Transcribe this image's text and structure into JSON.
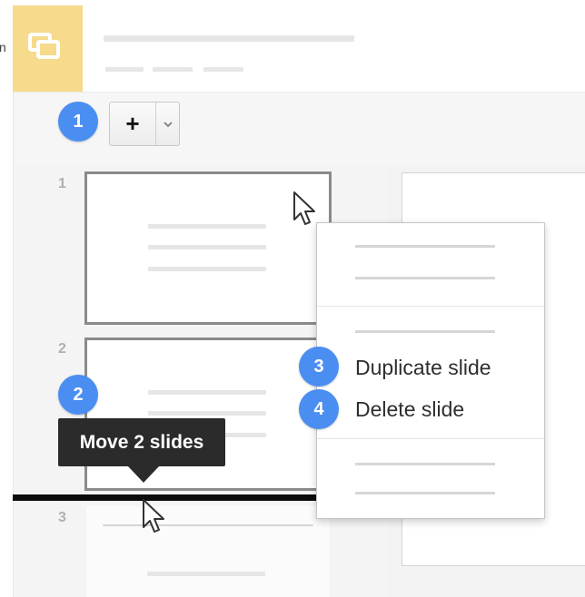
{
  "edge_text": "n",
  "toolbar": {
    "new_slide_label": "+",
    "step_badge": "1"
  },
  "slides": [
    {
      "number": "1"
    },
    {
      "number": "2",
      "step_badge": "2"
    },
    {
      "number": "3"
    }
  ],
  "tooltip": {
    "text": "Move 2 slides"
  },
  "context_menu": {
    "items": [
      {
        "step_badge": "3",
        "label": "Duplicate slide"
      },
      {
        "step_badge": "4",
        "label": "Delete slide"
      }
    ]
  },
  "colors": {
    "logo_bg": "#f6db8c",
    "badge_blue": "#4b8ef2",
    "tooltip_bg": "#2b2b2b"
  },
  "icons": [
    "slides-logo-icon",
    "plus-icon",
    "chevron-down-icon",
    "cursor-arrow-icon"
  ]
}
